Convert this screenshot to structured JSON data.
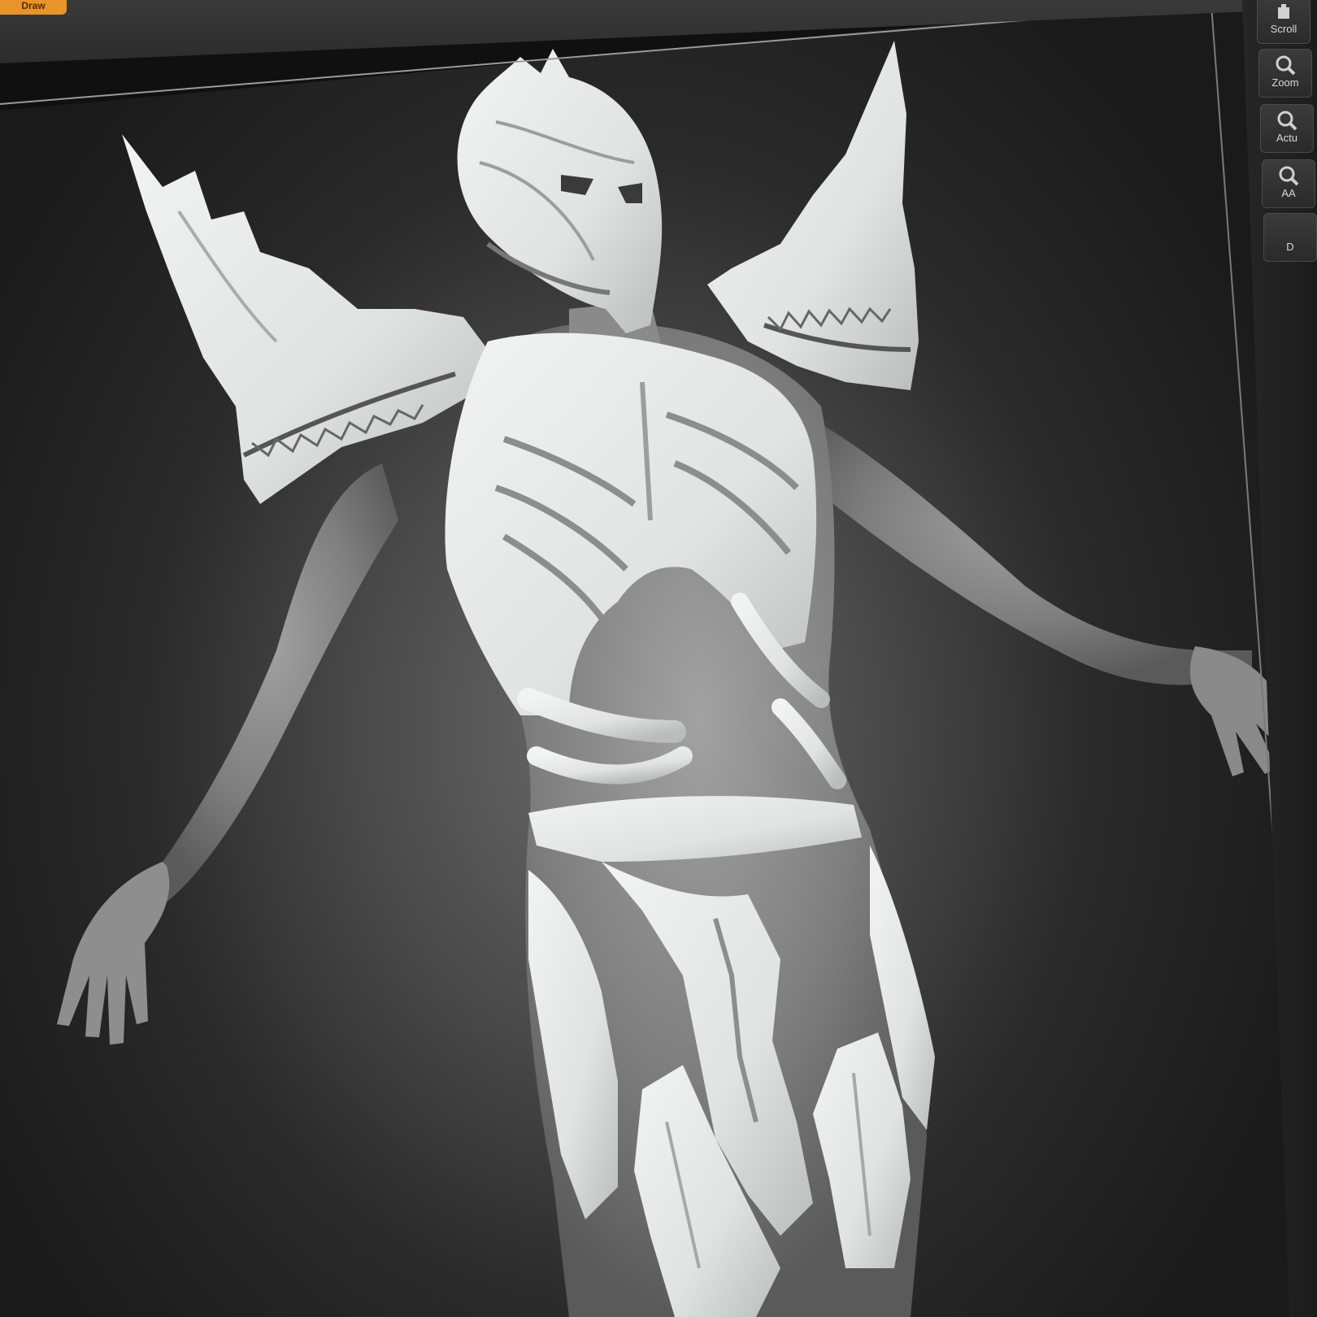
{
  "app": {
    "draw_button": "Draw"
  },
  "right_shelf": {
    "buttons": [
      {
        "label": "Scroll",
        "icon": "scroll-icon"
      },
      {
        "label": "Zoom",
        "icon": "zoom-icon"
      },
      {
        "label": "Actu",
        "icon": "actual-size-icon"
      },
      {
        "label": "AA",
        "icon": "aahalf-icon"
      },
      {
        "label": "D",
        "icon": "dynamic-icon"
      }
    ]
  },
  "viewport": {
    "subject": "sculpt-figure",
    "colors": {
      "background_center": "#6a6a6a",
      "background_edge": "#1a1a1a",
      "skin": "#8c8c8c",
      "armor": "#e4e8e6",
      "accent": "#e8942a"
    }
  }
}
